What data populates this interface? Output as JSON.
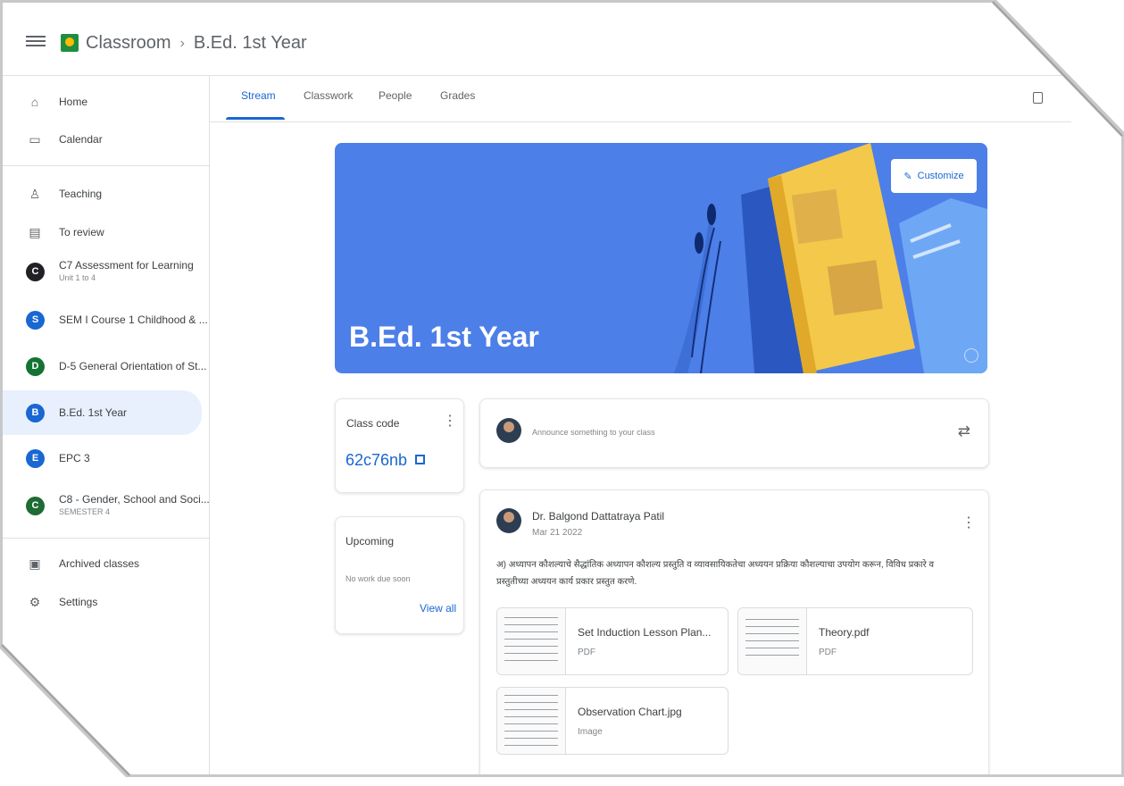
{
  "header": {
    "app_name": "Classroom",
    "separator": "›",
    "class_name": "B.Ed. 1st Year"
  },
  "sidebar": {
    "top_items": [
      {
        "label": "Home",
        "icon": "home-icon"
      },
      {
        "label": "Calendar",
        "icon": "calendar-icon"
      }
    ],
    "teaching_items": [
      {
        "label": "Teaching",
        "icon": "people-icon"
      },
      {
        "label": "To review",
        "icon": "review-icon"
      }
    ],
    "classes": [
      {
        "initial": "C",
        "label": "C7 Assessment for Learning",
        "sub": "Unit 1 to 4",
        "color": "#202124"
      },
      {
        "initial": "S",
        "label": "SEM I Course 1 Childhood & ...",
        "sub": "",
        "color": "#1967d2"
      },
      {
        "initial": "D",
        "label": "D-5 General Orientation of St...",
        "sub": "",
        "color": "#137333"
      },
      {
        "initial": "B",
        "label": "B.Ed. 1st Year",
        "sub": "",
        "color": "#1967d2"
      },
      {
        "initial": "E",
        "label": "EPC 3",
        "sub": "",
        "color": "#1967d2"
      },
      {
        "initial": "C",
        "label": "C8 - Gender, School and Soci...",
        "sub": "SEMESTER 4",
        "color": "#1e6b34"
      }
    ],
    "bottom_items": [
      {
        "label": "Archived classes",
        "icon": "archive-icon"
      },
      {
        "label": "Settings",
        "icon": "settings-icon"
      }
    ]
  },
  "tabs": [
    "Stream",
    "Classwork",
    "People",
    "Grades"
  ],
  "banner": {
    "title": "B.Ed. 1st Year",
    "customize_label": "Customize"
  },
  "class_code": {
    "label": "Class code",
    "value": "62c76nb"
  },
  "upcoming": {
    "title": "Upcoming",
    "empty_text": "No work due soon",
    "link": "View all"
  },
  "announce": {
    "placeholder": "Announce something to your class"
  },
  "post": {
    "author": "Dr. Balgond Dattatraya Patil",
    "date": "Mar 21 2022",
    "text": "अ) अध्यापन कौशल्याचे सैद्धांतिक अध्यापन कौशल्य प्रस्तुति व व्यावसायिकतेचा अध्ययन प्रक्रिया कौशल्याचा उपयोग करून, विविध प्रकारे व प्रस्तुतीच्या अध्ययन कार्य प्रकार प्रस्तुत करणे.",
    "attachments": [
      {
        "name": "Set Induction Lesson Plan...",
        "type": "PDF"
      },
      {
        "name": "Theory.pdf",
        "type": "PDF"
      },
      {
        "name": "Observation Chart.jpg",
        "type": "Image"
      }
    ]
  },
  "colors": {
    "accent": "#1967d2",
    "banner": "#4d7fe8",
    "selected_bg": "#e8f0fe"
  }
}
